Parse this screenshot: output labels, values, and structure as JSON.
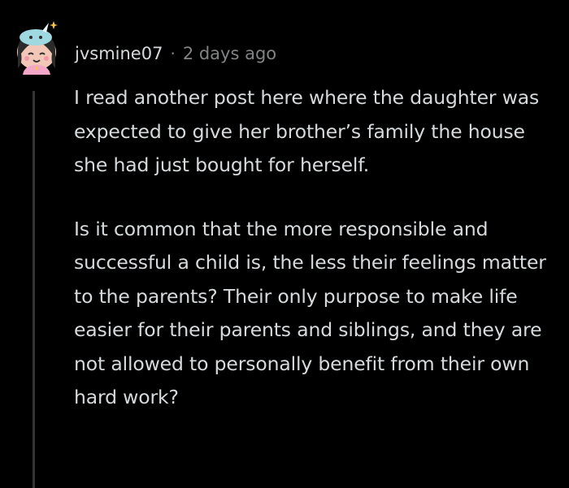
{
  "comment": {
    "username": "jvsmine07",
    "separator": "·",
    "timestamp": "2 days ago",
    "avatar_icon": "snoo-avatar-icon",
    "paragraphs": [
      "I read another post here where the daughter was expected to give her brother’s family the house she had just bought for herself.",
      "Is it common that the more responsible and successful a child is, the less their feelings matter to the parents? Their only purpose to make life easier for their parents and siblings, and they are not allowed to personally benefit from their own hard work?"
    ]
  },
  "colors": {
    "background": "#000000",
    "text": "#d7dadc",
    "meta": "#818384",
    "thread_line": "#343536"
  }
}
